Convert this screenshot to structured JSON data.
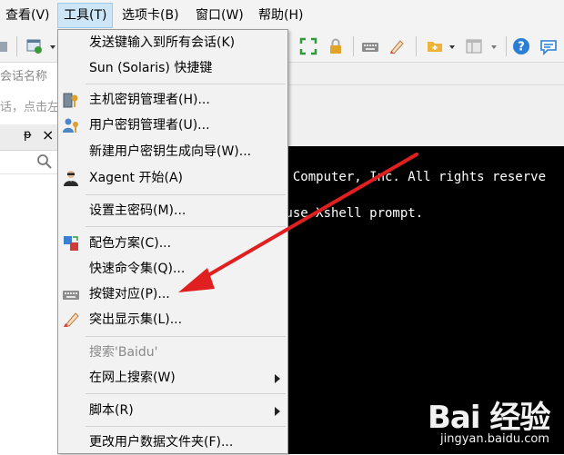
{
  "menubar": {
    "items": [
      {
        "label": "查看(V)"
      },
      {
        "label": "工具(T)",
        "active": true
      },
      {
        "label": "选项卡(B)"
      },
      {
        "label": "窗口(W)"
      },
      {
        "label": "帮助(H)"
      }
    ]
  },
  "left_panel": {
    "session_name_placeholder": "会话名称",
    "hint_text": "话，点击左",
    "pin_label": "ᵽ",
    "close_label": "×"
  },
  "terminal": {
    "lines": [
      "g Computer, Inc. All rights reserve",
      " use Xshell prompt."
    ]
  },
  "tools_menu": {
    "items": [
      {
        "label": "发送键输入到所有会话(K)",
        "icon": "none"
      },
      {
        "label": "Sun (Solaris) 快捷键",
        "icon": "none"
      },
      {
        "label": "主机密钥管理者(H)...",
        "icon": "host-key-icon"
      },
      {
        "label": "用户密钥管理者(U)...",
        "icon": "user-key-icon"
      },
      {
        "label": "新建用户密钥生成向导(W)...",
        "icon": "none"
      },
      {
        "label": "Xagent 开始(A)",
        "icon": "xagent-icon"
      },
      {
        "label": "设置主密码(M)...",
        "icon": "none"
      },
      {
        "label": "配色方案(C)...",
        "icon": "color-scheme-icon"
      },
      {
        "label": "快速命令集(Q)...",
        "icon": "none"
      },
      {
        "label": "按键对应(P)...",
        "icon": "keyboard-icon"
      },
      {
        "label": "突出显示集(L)...",
        "icon": "highlight-icon"
      },
      {
        "label": "搜索'Baidu'",
        "icon": "none",
        "disabled": true
      },
      {
        "label": "在网上搜索(W)",
        "icon": "none",
        "submenu": true
      },
      {
        "label": "脚本(R)",
        "icon": "none",
        "submenu": true
      },
      {
        "label": "更改用户数据文件夹(F)...",
        "icon": "none"
      }
    ]
  },
  "watermark": {
    "brand": "Bai 经验",
    "site": "jingyan.baidu.com"
  },
  "colors": {
    "menu_bg": "#f2f2f2",
    "active_menu": "#cde6f7",
    "terminal_bg": "#000000",
    "annotation_arrow": "#e02020"
  }
}
